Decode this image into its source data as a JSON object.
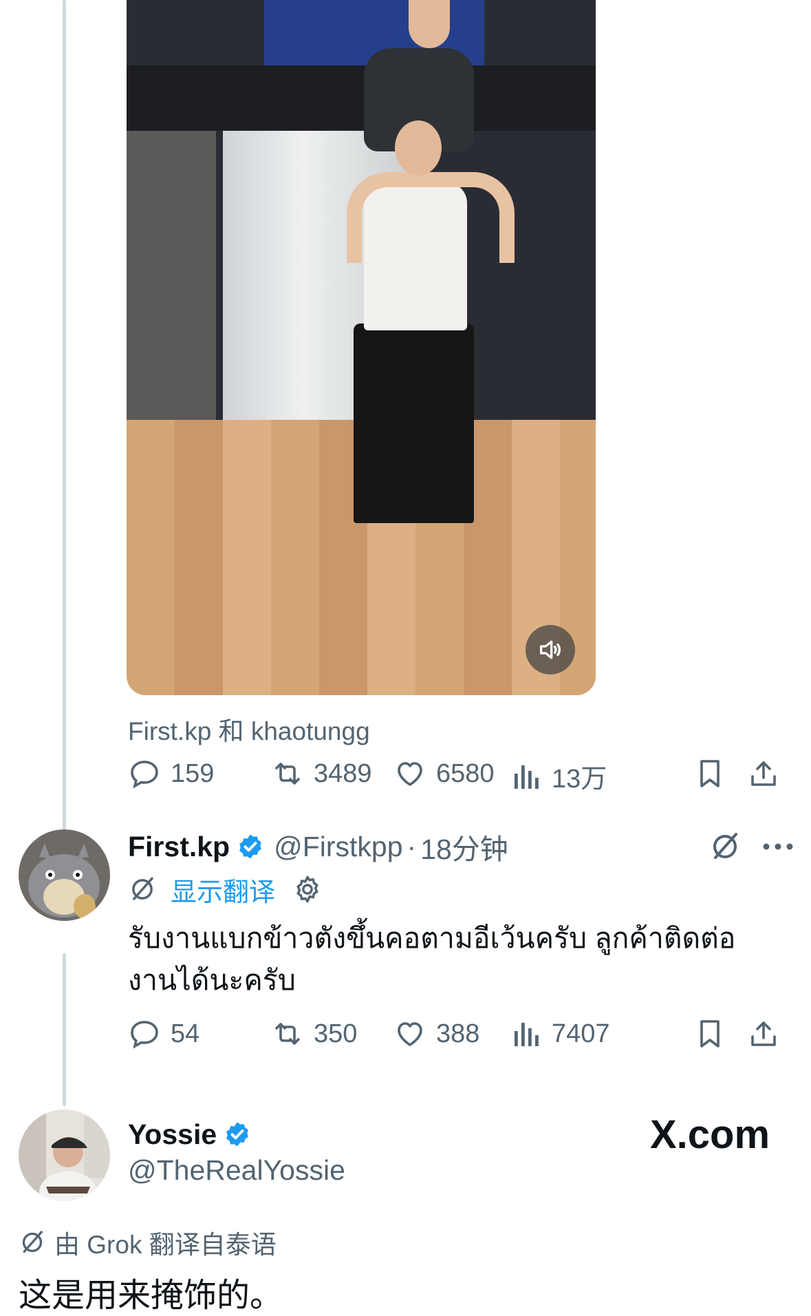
{
  "video": {
    "credits": "First.kp 和 khaotungg",
    "mute_icon": "speaker-icon"
  },
  "video_post_actions": {
    "replies": "159",
    "reposts": "3489",
    "likes": "6580",
    "views": "13万"
  },
  "reply_post": {
    "author_name": "First.kp",
    "author_handle": "@Firstkpp",
    "separator": "·",
    "time": "18分钟",
    "show_translation": "显示翻译",
    "text": "รับงานแบกข้าวตังขึ้นคอตามอีเว้นครับ ลูกค้าติดต่องานได้นะครับ",
    "actions": {
      "replies": "54",
      "reposts": "350",
      "likes": "388",
      "views": "7407"
    }
  },
  "quote_card": {
    "author_name": "Yossie",
    "author_handle": "@TheRealYossie",
    "source_logo": "X.com",
    "grok_label": "由 Grok 翻译自泰语",
    "translated_text": "这是用来掩饰的。"
  },
  "colors": {
    "accent_blue": "#1d9bf0",
    "secondary_text": "#536471",
    "primary_text": "#0f1419",
    "thread_line": "#cfd9de"
  }
}
